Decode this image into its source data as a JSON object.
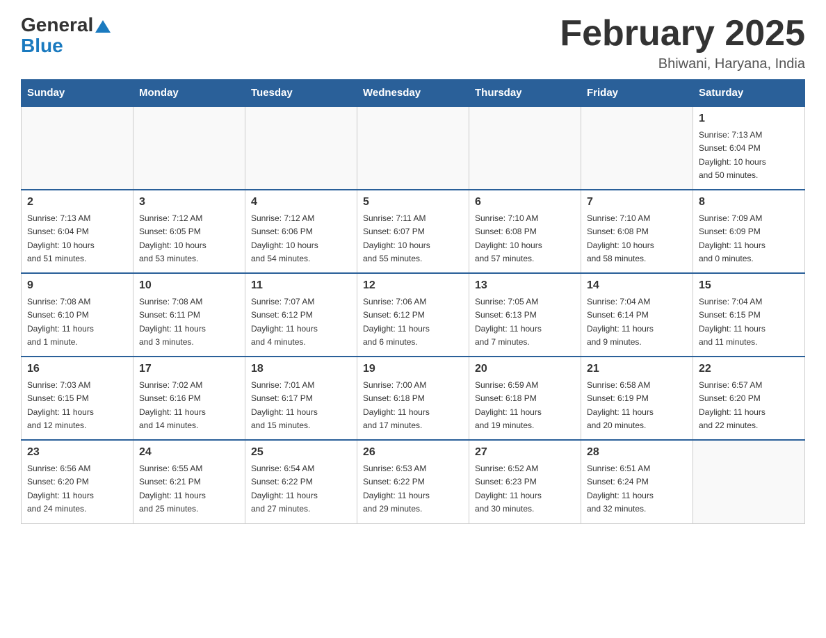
{
  "header": {
    "logo_general": "General",
    "logo_blue": "Blue",
    "month_title": "February 2025",
    "location": "Bhiwani, Haryana, India"
  },
  "days_of_week": [
    "Sunday",
    "Monday",
    "Tuesday",
    "Wednesday",
    "Thursday",
    "Friday",
    "Saturday"
  ],
  "weeks": [
    [
      {
        "day": "",
        "info": ""
      },
      {
        "day": "",
        "info": ""
      },
      {
        "day": "",
        "info": ""
      },
      {
        "day": "",
        "info": ""
      },
      {
        "day": "",
        "info": ""
      },
      {
        "day": "",
        "info": ""
      },
      {
        "day": "1",
        "info": "Sunrise: 7:13 AM\nSunset: 6:04 PM\nDaylight: 10 hours\nand 50 minutes."
      }
    ],
    [
      {
        "day": "2",
        "info": "Sunrise: 7:13 AM\nSunset: 6:04 PM\nDaylight: 10 hours\nand 51 minutes."
      },
      {
        "day": "3",
        "info": "Sunrise: 7:12 AM\nSunset: 6:05 PM\nDaylight: 10 hours\nand 53 minutes."
      },
      {
        "day": "4",
        "info": "Sunrise: 7:12 AM\nSunset: 6:06 PM\nDaylight: 10 hours\nand 54 minutes."
      },
      {
        "day": "5",
        "info": "Sunrise: 7:11 AM\nSunset: 6:07 PM\nDaylight: 10 hours\nand 55 minutes."
      },
      {
        "day": "6",
        "info": "Sunrise: 7:10 AM\nSunset: 6:08 PM\nDaylight: 10 hours\nand 57 minutes."
      },
      {
        "day": "7",
        "info": "Sunrise: 7:10 AM\nSunset: 6:08 PM\nDaylight: 10 hours\nand 58 minutes."
      },
      {
        "day": "8",
        "info": "Sunrise: 7:09 AM\nSunset: 6:09 PM\nDaylight: 11 hours\nand 0 minutes."
      }
    ],
    [
      {
        "day": "9",
        "info": "Sunrise: 7:08 AM\nSunset: 6:10 PM\nDaylight: 11 hours\nand 1 minute."
      },
      {
        "day": "10",
        "info": "Sunrise: 7:08 AM\nSunset: 6:11 PM\nDaylight: 11 hours\nand 3 minutes."
      },
      {
        "day": "11",
        "info": "Sunrise: 7:07 AM\nSunset: 6:12 PM\nDaylight: 11 hours\nand 4 minutes."
      },
      {
        "day": "12",
        "info": "Sunrise: 7:06 AM\nSunset: 6:12 PM\nDaylight: 11 hours\nand 6 minutes."
      },
      {
        "day": "13",
        "info": "Sunrise: 7:05 AM\nSunset: 6:13 PM\nDaylight: 11 hours\nand 7 minutes."
      },
      {
        "day": "14",
        "info": "Sunrise: 7:04 AM\nSunset: 6:14 PM\nDaylight: 11 hours\nand 9 minutes."
      },
      {
        "day": "15",
        "info": "Sunrise: 7:04 AM\nSunset: 6:15 PM\nDaylight: 11 hours\nand 11 minutes."
      }
    ],
    [
      {
        "day": "16",
        "info": "Sunrise: 7:03 AM\nSunset: 6:15 PM\nDaylight: 11 hours\nand 12 minutes."
      },
      {
        "day": "17",
        "info": "Sunrise: 7:02 AM\nSunset: 6:16 PM\nDaylight: 11 hours\nand 14 minutes."
      },
      {
        "day": "18",
        "info": "Sunrise: 7:01 AM\nSunset: 6:17 PM\nDaylight: 11 hours\nand 15 minutes."
      },
      {
        "day": "19",
        "info": "Sunrise: 7:00 AM\nSunset: 6:18 PM\nDaylight: 11 hours\nand 17 minutes."
      },
      {
        "day": "20",
        "info": "Sunrise: 6:59 AM\nSunset: 6:18 PM\nDaylight: 11 hours\nand 19 minutes."
      },
      {
        "day": "21",
        "info": "Sunrise: 6:58 AM\nSunset: 6:19 PM\nDaylight: 11 hours\nand 20 minutes."
      },
      {
        "day": "22",
        "info": "Sunrise: 6:57 AM\nSunset: 6:20 PM\nDaylight: 11 hours\nand 22 minutes."
      }
    ],
    [
      {
        "day": "23",
        "info": "Sunrise: 6:56 AM\nSunset: 6:20 PM\nDaylight: 11 hours\nand 24 minutes."
      },
      {
        "day": "24",
        "info": "Sunrise: 6:55 AM\nSunset: 6:21 PM\nDaylight: 11 hours\nand 25 minutes."
      },
      {
        "day": "25",
        "info": "Sunrise: 6:54 AM\nSunset: 6:22 PM\nDaylight: 11 hours\nand 27 minutes."
      },
      {
        "day": "26",
        "info": "Sunrise: 6:53 AM\nSunset: 6:22 PM\nDaylight: 11 hours\nand 29 minutes."
      },
      {
        "day": "27",
        "info": "Sunrise: 6:52 AM\nSunset: 6:23 PM\nDaylight: 11 hours\nand 30 minutes."
      },
      {
        "day": "28",
        "info": "Sunrise: 6:51 AM\nSunset: 6:24 PM\nDaylight: 11 hours\nand 32 minutes."
      },
      {
        "day": "",
        "info": ""
      }
    ]
  ]
}
